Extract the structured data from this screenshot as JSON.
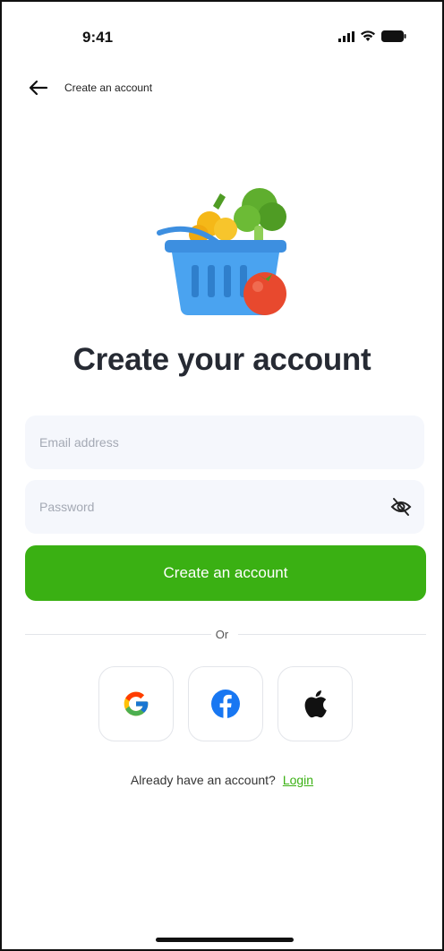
{
  "status_bar": {
    "time": "9:41",
    "icons": [
      "signal-icon",
      "wifi-icon",
      "battery-icon"
    ]
  },
  "header": {
    "back_icon": "arrow-left-icon",
    "title": "Create an account"
  },
  "illustration": "grocery-basket-icon",
  "page_title": "Create your account",
  "form": {
    "email": {
      "value": "",
      "placeholder": "Email address"
    },
    "password": {
      "value": "",
      "placeholder": "Password",
      "toggle_icon": "eye-off-icon"
    },
    "submit_label": "Create an account"
  },
  "divider_text": "Or",
  "social": [
    {
      "name": "google",
      "icon": "google-icon"
    },
    {
      "name": "facebook",
      "icon": "facebook-icon"
    },
    {
      "name": "apple",
      "icon": "apple-icon"
    }
  ],
  "login_prompt": {
    "text": "Already have an account?",
    "link": "Login"
  },
  "colors": {
    "accent": "#3ab013",
    "input_bg": "#f5f7fc",
    "title": "#262a33",
    "facebook": "#1877f2"
  }
}
